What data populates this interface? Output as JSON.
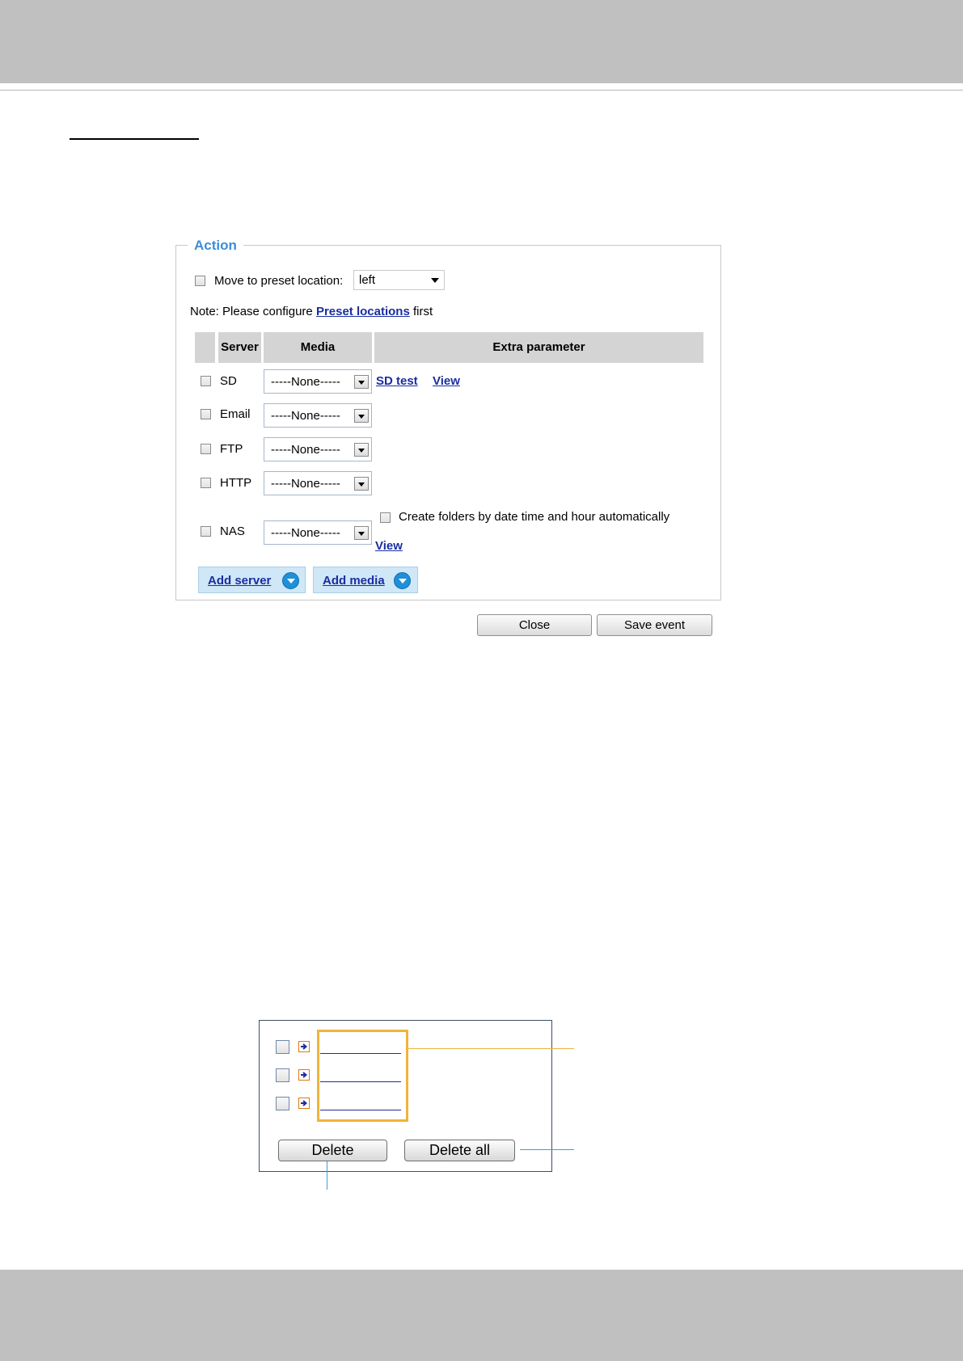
{
  "action_panel": {
    "legend": "Action",
    "move_preset": {
      "label": "Move to preset location:",
      "value": "left"
    },
    "note": {
      "prefix": "Note: Please configure ",
      "link": "Preset locations",
      "suffix": " first"
    },
    "table": {
      "headers": {
        "server": "Server",
        "media": "Media",
        "extra": "Extra parameter"
      },
      "rows": [
        {
          "server": "SD",
          "media": "-----None-----",
          "extra_links": [
            "SD test",
            "View"
          ]
        },
        {
          "server": "Email",
          "media": "-----None-----"
        },
        {
          "server": "FTP",
          "media": "-----None-----"
        },
        {
          "server": "HTTP",
          "media": "-----None-----"
        },
        {
          "server": "NAS",
          "media": "-----None-----",
          "extra_checkbox": "Create folders by date time and hour automatically",
          "extra_link": "View"
        }
      ]
    },
    "add_server": "Add server",
    "add_media": "Add media",
    "close": "Close",
    "save_event": "Save event"
  },
  "file_list": {
    "delete": "Delete",
    "delete_all": "Delete all"
  },
  "colors": {
    "band": "#bfc0bf",
    "legend": "#3a8ed8",
    "link": "#1a2ea0",
    "highlight": "#f0b43a",
    "callout_blue": "#3aa0d8"
  }
}
